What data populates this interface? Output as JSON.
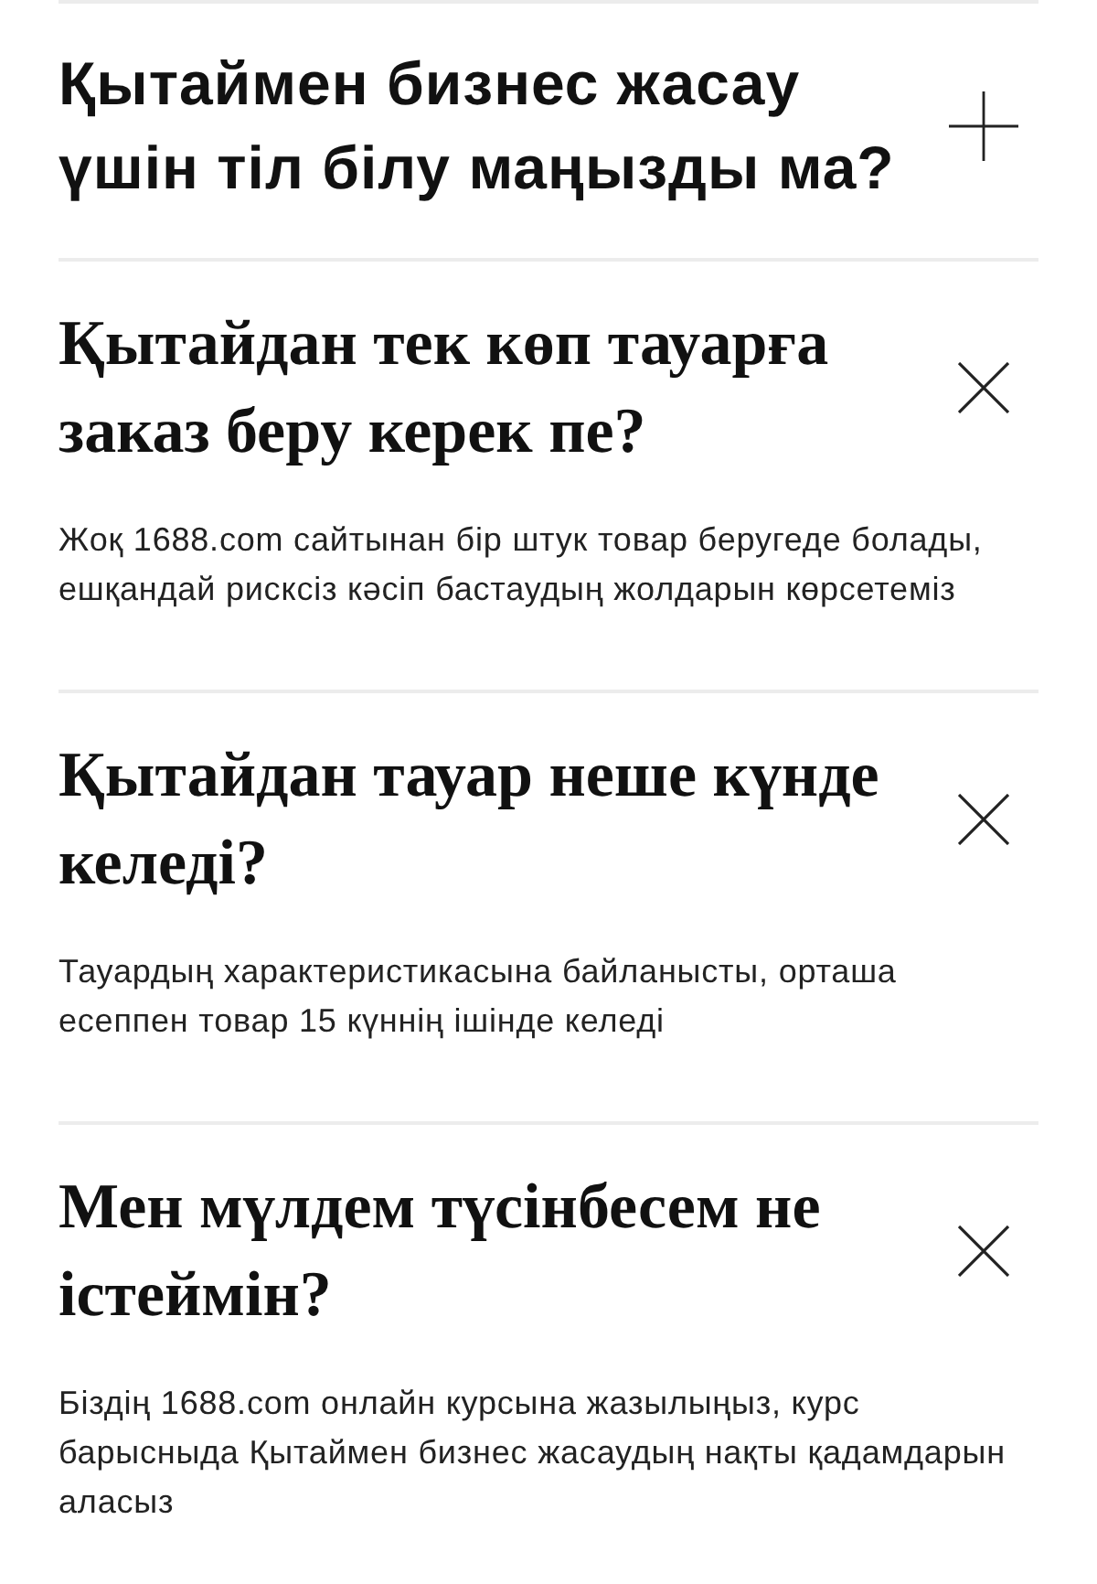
{
  "faq": [
    {
      "question": "Қытаймен бизнес жасау үшін тіл білу маңызды ма?",
      "expanded": false
    },
    {
      "question": "Қытайдан тек көп тауарға заказ беру керек пе?",
      "expanded": true,
      "answer": "Жоқ 1688.com сайтынан бір штук товар беругеде болады, ешқандай рисксіз кәсіп бастаудың жолдарын көрсетеміз"
    },
    {
      "question": "Қытайдан тауар неше күнде келеді?",
      "expanded": true,
      "answer": "Тауардың характеристикасына байланысты, орташа есеппен товар 15 күннің ішінде келеді"
    },
    {
      "question": "Мен мүлдем түсінбесем не істеймін?",
      "expanded": true,
      "answer": "Біздің 1688.com онлайн курсына жазылыңыз, курс барысныда Қытаймен бизнес жасаудың нақты қадамдарын аласыз"
    }
  ]
}
